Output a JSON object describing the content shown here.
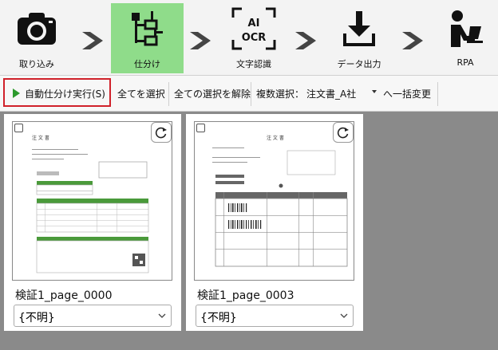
{
  "workflow": {
    "steps": [
      {
        "label": "取り込み",
        "icon": "camera-icon"
      },
      {
        "label": "仕分け",
        "icon": "sort-tree-icon",
        "active": true
      },
      {
        "label": "文字認識",
        "icon": "ai-ocr-icon",
        "icon_text_1": "AI",
        "icon_text_2": "OCR"
      },
      {
        "label": "データ出力",
        "icon": "download-icon"
      },
      {
        "label": "RPA",
        "icon": "desk-person-icon"
      }
    ],
    "active_color": "#8fdc8a"
  },
  "toolbar": {
    "run_label": "自動仕分け実行(S)",
    "select_all": "全てを選択",
    "clear_selection": "全ての選択を解除",
    "multi_select_label": "複数選択：",
    "multi_select_value": "注文書_A社",
    "bulk_change": "へ一括変更",
    "highlight_color": "#d0212a"
  },
  "cards": [
    {
      "filename": "検証1_page_0000",
      "category": "{不明}",
      "doc_title": "注 文 書"
    },
    {
      "filename": "検証1_page_0003",
      "category": "{不明}",
      "doc_title": "注 文 書"
    }
  ]
}
